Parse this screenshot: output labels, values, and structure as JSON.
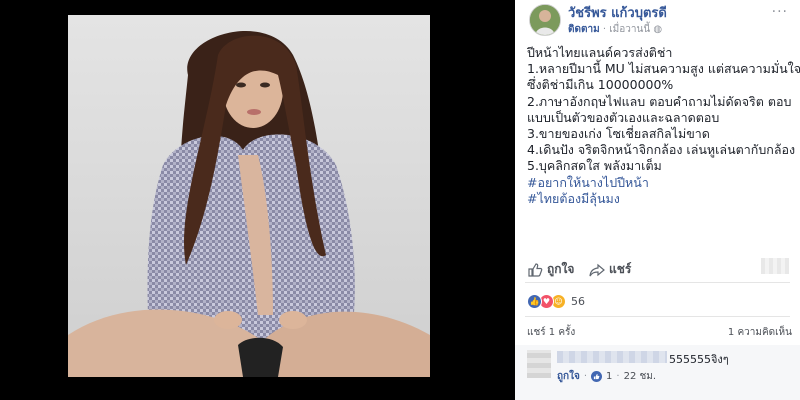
{
  "post": {
    "author": "วัชรีพร แก้วบุตรดี",
    "follow_label": "ติดตาม",
    "time": "เมื่อวานนี้",
    "more_label": "···",
    "caption_lines": [
      "ปีหน้าไทยแลนด์ควรส่งติช่า",
      "1.หลายปีมานี้ MU ไม่สนความสูง แต่สนความมั่นใจ",
      "ซึ่งติช่ามีเกิน 10000000%",
      "2.ภาษาอังกฤษไฟแลบ ตอบคำถามไม่ดัดจริต ตอบ",
      "แบบเป็นตัวของตัวเองและฉลาดตอบ",
      "3.ขายของเก่ง โซเชี่ยลสกิลไม่ขาด",
      "4.เดินปัง จริตจิกหน้าจิกกล้อง เล่นหูเล่นตากับกล้อง",
      "5.บุคลิกสดใส พลังมาเต็ม"
    ],
    "hashtags": [
      "#อยากให้นางไปปีหน้า",
      "#ไทยต้องมีลุ้นมง"
    ]
  },
  "actions": {
    "like_label": "ถูกใจ",
    "share_label": "แชร์"
  },
  "reactions": {
    "count": "56",
    "colors": {
      "like": "#4267b2",
      "love": "#f25268",
      "haha": "#f7b125"
    }
  },
  "stats": {
    "shares": "แชร์ 1 ครั้ง",
    "comments": "1 ความคิดเห็น"
  },
  "comment": {
    "text": "555555จิงๆ",
    "like_label": "ถูกใจ",
    "like_count": "1",
    "time": "22 ชม."
  },
  "colors": {
    "link": "#365899",
    "text": "#1d2129",
    "muted": "#90949c"
  }
}
